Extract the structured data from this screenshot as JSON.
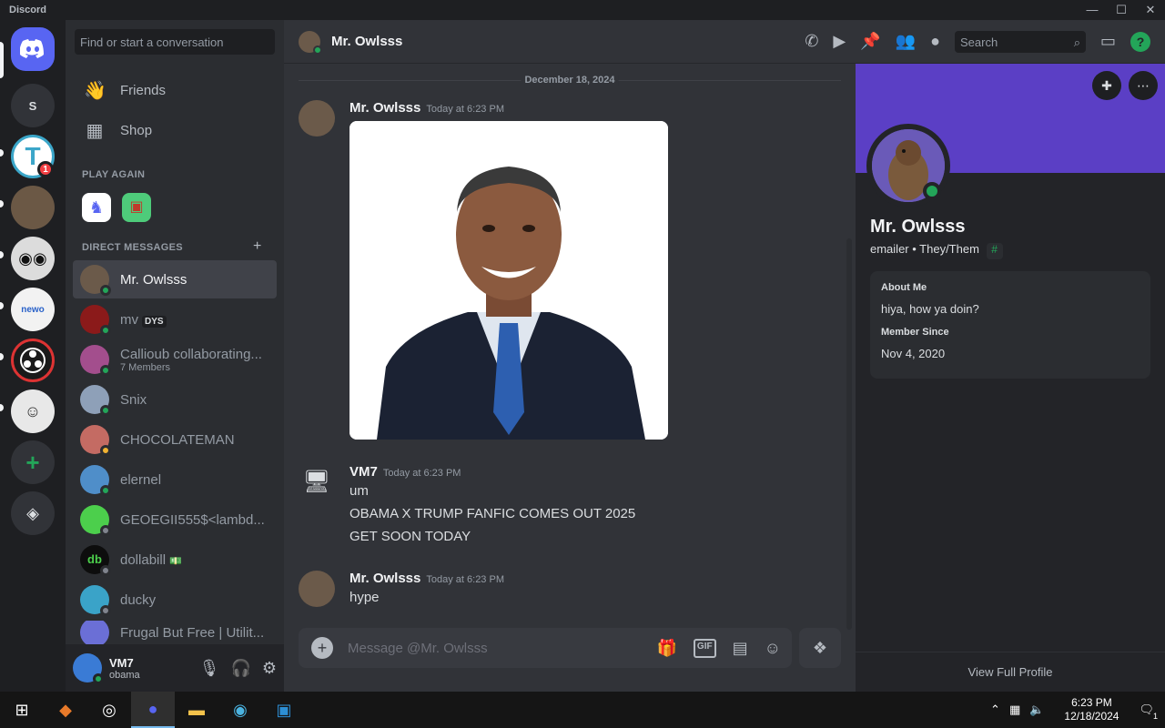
{
  "window": {
    "title": "Discord",
    "controls": [
      "—",
      "☐",
      "✕"
    ]
  },
  "servers": [
    {
      "label": "S",
      "color": "#313338"
    },
    {
      "label": "T",
      "color": "#3ba6c9",
      "badge": "1"
    },
    {
      "label": "",
      "color": "#6b5845"
    },
    {
      "label": "",
      "color": "#dcdcdc"
    },
    {
      "label": "newo",
      "color": "#f2f2f2"
    },
    {
      "label": "",
      "color": "#1a1a1a"
    },
    {
      "label": "",
      "color": "#e8e8e8"
    }
  ],
  "dm_panel": {
    "search_placeholder": "Find or start a conversation",
    "nav": [
      {
        "label": "Friends"
      },
      {
        "label": "Shop"
      }
    ],
    "play_again_label": "PLAY AGAIN",
    "direct_messages_label": "DIRECT MESSAGES",
    "add_dm": "+",
    "dms": [
      {
        "name": "Mr. Owlsss",
        "status": "#23a559",
        "color": "#6b5a4a"
      },
      {
        "name": "mv",
        "tag": "DYS",
        "status": "#23a559",
        "color": "#8b1a1a"
      },
      {
        "name": "Callioub collaborating...",
        "sub": "7 Members",
        "status": "#23a559",
        "color": "#a34e8d"
      },
      {
        "name": "Snix",
        "status": "#23a559",
        "color": "#8ea0b8"
      },
      {
        "name": "CHOCOLATEMAN",
        "status": "#f0b232",
        "color": "#c46b63"
      },
      {
        "name": "elernel",
        "status": "#23a559",
        "color": "#4f8ec9"
      },
      {
        "name": "GEOEGII555$<lambd...",
        "status": "#80848e",
        "color": "#4ccf4c"
      },
      {
        "name": "dollabill",
        "tag": "💵",
        "status": "#80848e",
        "color": "#0d0d0d"
      },
      {
        "name": "ducky",
        "status": "#80848e",
        "color": "#3aa3c8"
      },
      {
        "name": "Frugal But Free | Utilit...",
        "status": "#80848e",
        "color": "#6b6fd6"
      }
    ],
    "user": {
      "name": "VM7",
      "sub": "obama"
    }
  },
  "header": {
    "title": "Mr. Owlsss",
    "search_placeholder": "Search"
  },
  "chat": {
    "date": "December 18, 2024",
    "messages": [
      {
        "author": "Mr. Owlsss",
        "time": "Today at 6:23 PM",
        "lines": []
      },
      {
        "author": "VM7",
        "time": "Today at 6:23 PM",
        "lines": [
          "um",
          "OBAMA X TRUMP FANFIC COMES OUT 2025",
          "GET SOON TODAY"
        ]
      },
      {
        "author": "Mr. Owlsss",
        "time": "Today at 6:23 PM",
        "lines": [
          "hype"
        ]
      }
    ],
    "composer_placeholder": "Message @Mr. Owlsss"
  },
  "profile": {
    "name": "Mr. Owlsss",
    "pronouns": "emailer • They/Them",
    "about_label": "About Me",
    "about": "hiya, how ya doin?",
    "member_since_label": "Member Since",
    "member_since": "Nov 4, 2020",
    "view_full": "View Full Profile"
  },
  "taskbar": {
    "time": "6:23 PM",
    "date": "12/18/2024",
    "notif": "1"
  },
  "colors": {
    "accent": "#5865f2",
    "banner": "#5b3fc5",
    "online": "#23a559"
  }
}
